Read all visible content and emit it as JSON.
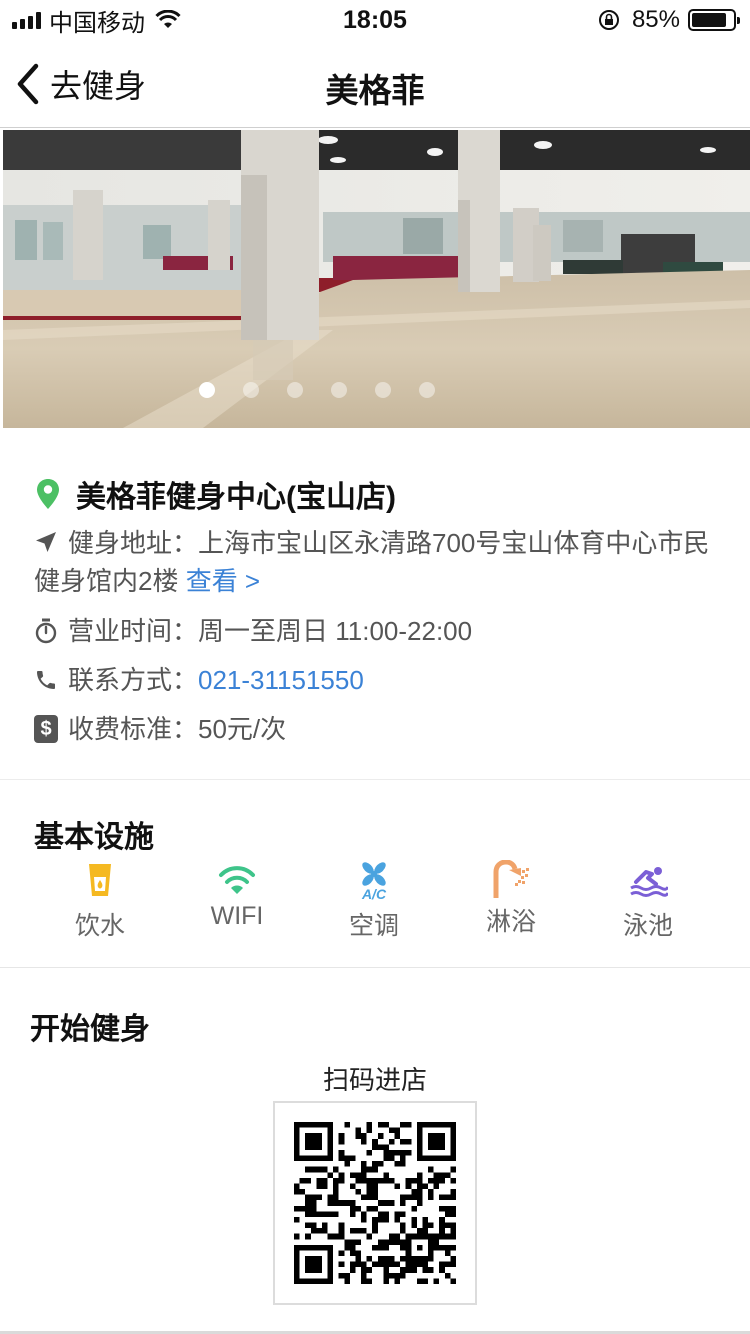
{
  "status_bar": {
    "carrier": "中国移动",
    "time": "18:05",
    "battery_percent": "85%",
    "battery_level": 0.85
  },
  "nav": {
    "back_label": "去健身",
    "title": "美格菲"
  },
  "carousel": {
    "slide_count": 6,
    "active_index": 0
  },
  "gym": {
    "name": "美格菲健身中心(宝山店)",
    "address_label": "健身地址：",
    "address_value": "上海市宝山区永清路700号宝山体育中心市民健身馆内2楼",
    "address_link": "查看 >",
    "hours_label": "营业时间：",
    "hours_value": "周一至周日 11:00-22:00",
    "phone_label": "联系方式：",
    "phone_value": "021-31151550",
    "fee_label": "收费标准：",
    "fee_value": "50元/次",
    "fee_icon_glyph": "$"
  },
  "facilities": {
    "title": "基本设施",
    "items": [
      {
        "label": "饮水",
        "icon": "water-cup-icon",
        "color": "#f5b921"
      },
      {
        "label": "WIFI",
        "icon": "wifi-icon",
        "color": "#3ec48a"
      },
      {
        "label": "空调",
        "icon": "air-conditioner-icon",
        "color": "#4aa3df"
      },
      {
        "label": "淋浴",
        "icon": "shower-icon",
        "color": "#f0a36a"
      },
      {
        "label": "泳池",
        "icon": "swimming-icon",
        "color": "#7b5fd6"
      }
    ]
  },
  "start": {
    "title": "开始健身",
    "scan_label": "扫码进店"
  },
  "colors": {
    "link": "#3b82d6",
    "pin": "#4cc064"
  }
}
